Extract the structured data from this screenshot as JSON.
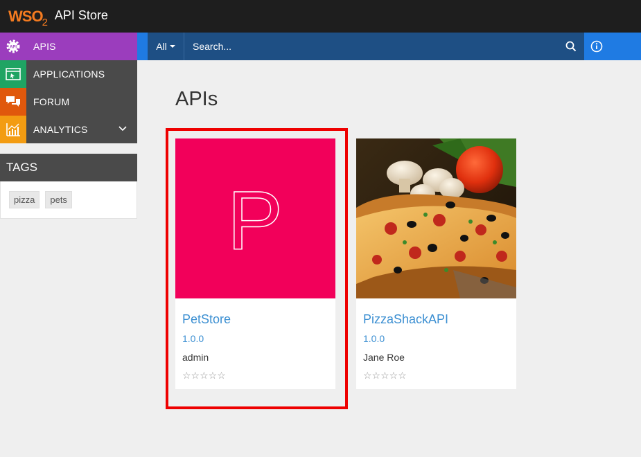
{
  "header": {
    "logo_text": "WSO",
    "logo_sub": "2",
    "title": "API Store"
  },
  "sidebar": {
    "items": [
      {
        "label": "APIS",
        "icon": "api-gear-icon",
        "color": "#9b3dbd"
      },
      {
        "label": "APPLICATIONS",
        "icon": "applications-icon",
        "color": "#1fa463"
      },
      {
        "label": "FORUM",
        "icon": "forum-chat-icon",
        "color": "#e0580c"
      },
      {
        "label": "ANALYTICS",
        "icon": "analytics-chart-icon",
        "color": "#f39c12"
      }
    ]
  },
  "tags": {
    "title": "TAGS",
    "items": [
      "pizza",
      "pets"
    ]
  },
  "search": {
    "filter_label": "All",
    "placeholder": "Search..."
  },
  "main": {
    "title": "APIs",
    "apis": [
      {
        "name": "PetStore",
        "version": "1.0.0",
        "owner": "admin",
        "rating": "☆☆☆☆☆",
        "thumb_letter": "P",
        "thumb_color": "#f2005a"
      },
      {
        "name": "PizzaShackAPI",
        "version": "1.0.0",
        "owner": "Jane Roe",
        "rating": "☆☆☆☆☆",
        "thumb": "pizza-photo"
      }
    ]
  },
  "colors": {
    "topbar": "#1e1e1e",
    "searchbar": "#1e4f84",
    "accent_blue": "#1f7be3",
    "link": "#3b8fd2",
    "highlight": "#ee0000"
  }
}
